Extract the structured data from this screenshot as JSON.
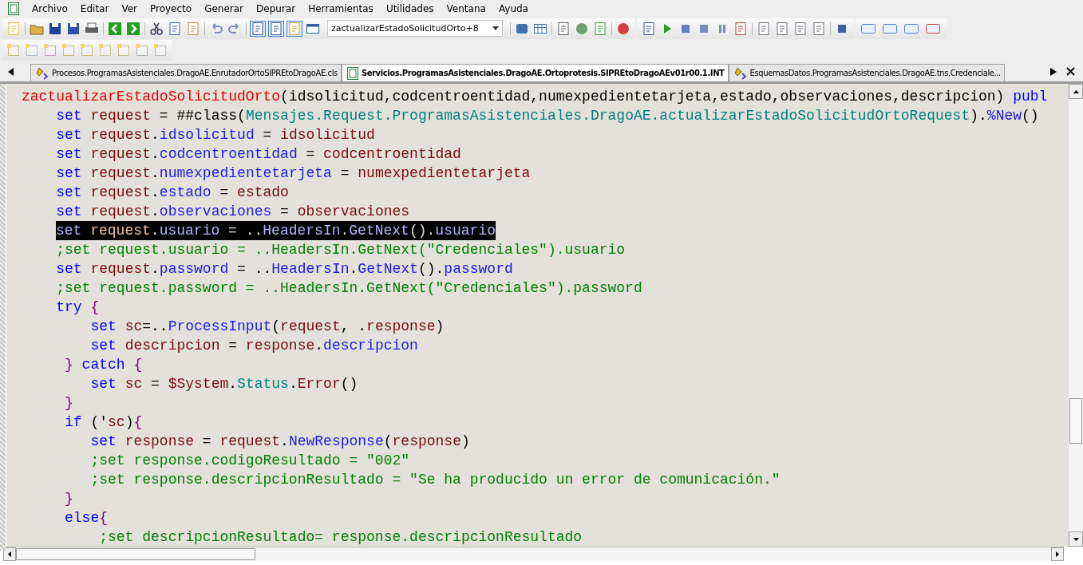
{
  "menu": [
    "Archivo",
    "Editar",
    "Ver",
    "Proyecto",
    "Generar",
    "Depurar",
    "Herramientas",
    "Utilidades",
    "Ventana",
    "Ayuda"
  ],
  "toolbar": {
    "dropdown": "zactualizarEstadoSolicitudOrto+8"
  },
  "tabs": [
    {
      "label": "Procesos.ProgramasAsistenciales.DragoAE.EnrutadorOrtoSIPREtoDragoAE.cls",
      "selected": false
    },
    {
      "label": "Servicios.ProgramasAsistenciales.DragoAE.Ortoprotesis.SIPREtoDragoAEv01r00.1.INT",
      "selected": true
    },
    {
      "label": "EsquemasDatos.ProgramasAsistenciales.DragoAE.tns.Credenciale...",
      "selected": false
    }
  ],
  "code": [
    {
      "highlighted": false,
      "tokens": [
        {
          "kind": "method",
          "text": "zactualizarEstadoSolicitudOrto"
        },
        {
          "kind": "plain",
          "text": "(idsolicitud,codcentroentidad,numexpedientetarjeta,estado,observaciones,descripcion) "
        },
        {
          "kind": "kw",
          "text": "publ"
        }
      ]
    },
    {
      "highlighted": false,
      "tokens": [
        {
          "kind": "kw",
          "text": "    set"
        },
        {
          "kind": "var",
          "text": " request"
        },
        {
          "kind": "plain",
          "text": " = ##class("
        },
        {
          "kind": "cls",
          "text": "Mensajes.Request.ProgramasAsistenciales.DragoAE.actualizarEstadoSolicitudOrtoRequest"
        },
        {
          "kind": "plain",
          "text": ")."
        },
        {
          "kind": "prop",
          "text": "%New"
        },
        {
          "kind": "plain",
          "text": "()"
        }
      ]
    },
    {
      "highlighted": false,
      "tokens": [
        {
          "kind": "kw",
          "text": "    set"
        },
        {
          "kind": "var",
          "text": " request"
        },
        {
          "kind": "plain",
          "text": "."
        },
        {
          "kind": "prop",
          "text": "idsolicitud"
        },
        {
          "kind": "plain",
          "text": " = "
        },
        {
          "kind": "var",
          "text": "idsolicitud"
        }
      ]
    },
    {
      "highlighted": false,
      "tokens": [
        {
          "kind": "kw",
          "text": "    set"
        },
        {
          "kind": "var",
          "text": " request"
        },
        {
          "kind": "plain",
          "text": "."
        },
        {
          "kind": "prop",
          "text": "codcentroentidad"
        },
        {
          "kind": "plain",
          "text": " = "
        },
        {
          "kind": "var",
          "text": "codcentroentidad"
        }
      ]
    },
    {
      "highlighted": false,
      "tokens": [
        {
          "kind": "kw",
          "text": "    set"
        },
        {
          "kind": "var",
          "text": " request"
        },
        {
          "kind": "plain",
          "text": "."
        },
        {
          "kind": "prop",
          "text": "numexpedientetarjeta"
        },
        {
          "kind": "plain",
          "text": " = "
        },
        {
          "kind": "var",
          "text": "numexpedientetarjeta"
        }
      ]
    },
    {
      "highlighted": false,
      "tokens": [
        {
          "kind": "kw",
          "text": "    set"
        },
        {
          "kind": "var",
          "text": " request"
        },
        {
          "kind": "plain",
          "text": "."
        },
        {
          "kind": "prop",
          "text": "estado"
        },
        {
          "kind": "plain",
          "text": " = "
        },
        {
          "kind": "var",
          "text": "estado"
        }
      ]
    },
    {
      "highlighted": false,
      "tokens": [
        {
          "kind": "kw",
          "text": "    set"
        },
        {
          "kind": "var",
          "text": " request"
        },
        {
          "kind": "plain",
          "text": "."
        },
        {
          "kind": "prop",
          "text": "observaciones"
        },
        {
          "kind": "plain",
          "text": " = "
        },
        {
          "kind": "var",
          "text": "observaciones"
        }
      ]
    },
    {
      "highlighted": true,
      "tokens": [
        {
          "kind": "kw",
          "text": "set"
        },
        {
          "kind": "var",
          "text": " request"
        },
        {
          "kind": "plain",
          "text": "."
        },
        {
          "kind": "prop",
          "text": "usuario"
        },
        {
          "kind": "plain",
          "text": " = .."
        },
        {
          "kind": "prop",
          "text": "HeadersIn"
        },
        {
          "kind": "plain",
          "text": "."
        },
        {
          "kind": "prop",
          "text": "GetNext"
        },
        {
          "kind": "plain",
          "text": "()."
        },
        {
          "kind": "prop",
          "text": "usuario"
        }
      ]
    },
    {
      "highlighted": false,
      "tokens": [
        {
          "kind": "comment",
          "text": "    ;set request.usuario = ..HeadersIn.GetNext(\"Credenciales\").usuario"
        }
      ]
    },
    {
      "highlighted": false,
      "tokens": [
        {
          "kind": "kw",
          "text": "    set"
        },
        {
          "kind": "var",
          "text": " request"
        },
        {
          "kind": "plain",
          "text": "."
        },
        {
          "kind": "prop",
          "text": "password"
        },
        {
          "kind": "plain",
          "text": " = .."
        },
        {
          "kind": "prop",
          "text": "HeadersIn"
        },
        {
          "kind": "plain",
          "text": "."
        },
        {
          "kind": "prop",
          "text": "GetNext"
        },
        {
          "kind": "plain",
          "text": "()."
        },
        {
          "kind": "prop",
          "text": "password"
        }
      ]
    },
    {
      "highlighted": false,
      "tokens": [
        {
          "kind": "comment",
          "text": "    ;set request.password = ..HeadersIn.GetNext(\"Credenciales\").password"
        }
      ]
    },
    {
      "highlighted": false,
      "tokens": [
        {
          "kind": "kw",
          "text": "    try"
        },
        {
          "kind": "brace",
          "text": " {"
        }
      ]
    },
    {
      "highlighted": false,
      "tokens": [
        {
          "kind": "kw",
          "text": "        set"
        },
        {
          "kind": "var",
          "text": " sc"
        },
        {
          "kind": "plain",
          "text": "=.."
        },
        {
          "kind": "prop",
          "text": "ProcessInput"
        },
        {
          "kind": "plain",
          "text": "("
        },
        {
          "kind": "var",
          "text": "request"
        },
        {
          "kind": "plain",
          "text": ", ."
        },
        {
          "kind": "var",
          "text": "response"
        },
        {
          "kind": "plain",
          "text": ")"
        }
      ]
    },
    {
      "highlighted": false,
      "tokens": [
        {
          "kind": "kw",
          "text": "        set"
        },
        {
          "kind": "var",
          "text": " descripcion"
        },
        {
          "kind": "plain",
          "text": " = "
        },
        {
          "kind": "var",
          "text": "response"
        },
        {
          "kind": "plain",
          "text": "."
        },
        {
          "kind": "prop",
          "text": "descripcion"
        }
      ]
    },
    {
      "highlighted": false,
      "tokens": [
        {
          "kind": "brace",
          "text": "     }"
        },
        {
          "kind": "kw",
          "text": " catch"
        },
        {
          "kind": "brace",
          "text": " {"
        }
      ]
    },
    {
      "highlighted": false,
      "tokens": [
        {
          "kind": "kw",
          "text": "        set"
        },
        {
          "kind": "var",
          "text": " sc"
        },
        {
          "kind": "plain",
          "text": " = "
        },
        {
          "kind": "var",
          "text": "$System"
        },
        {
          "kind": "plain",
          "text": "."
        },
        {
          "kind": "cls",
          "text": "Status"
        },
        {
          "kind": "plain",
          "text": "."
        },
        {
          "kind": "var",
          "text": "Error"
        },
        {
          "kind": "plain",
          "text": "()"
        }
      ]
    },
    {
      "highlighted": false,
      "tokens": [
        {
          "kind": "brace",
          "text": "     }"
        }
      ]
    },
    {
      "highlighted": false,
      "tokens": [
        {
          "kind": "kw",
          "text": "     if"
        },
        {
          "kind": "plain",
          "text": " ('"
        },
        {
          "kind": "var",
          "text": "sc"
        },
        {
          "kind": "plain",
          "text": ")"
        },
        {
          "kind": "brace",
          "text": "{"
        }
      ]
    },
    {
      "highlighted": false,
      "tokens": [
        {
          "kind": "kw",
          "text": "        set"
        },
        {
          "kind": "var",
          "text": " response"
        },
        {
          "kind": "plain",
          "text": " = "
        },
        {
          "kind": "var",
          "text": "request"
        },
        {
          "kind": "plain",
          "text": "."
        },
        {
          "kind": "prop",
          "text": "NewResponse"
        },
        {
          "kind": "plain",
          "text": "("
        },
        {
          "kind": "var",
          "text": "response"
        },
        {
          "kind": "plain",
          "text": ")"
        }
      ]
    },
    {
      "highlighted": false,
      "tokens": [
        {
          "kind": "comment",
          "text": "        ;set response.codigoResultado = \"002\""
        }
      ]
    },
    {
      "highlighted": false,
      "tokens": [
        {
          "kind": "comment",
          "text": "        ;set response.descripcionResultado = \"Se ha producido un error de comunicación.\""
        }
      ]
    },
    {
      "highlighted": false,
      "tokens": [
        {
          "kind": "brace",
          "text": "     }"
        }
      ]
    },
    {
      "highlighted": false,
      "tokens": [
        {
          "kind": "kw",
          "text": "     else"
        },
        {
          "kind": "brace",
          "text": "{"
        }
      ]
    },
    {
      "highlighted": false,
      "tokens": [
        {
          "kind": "comment",
          "text": "         ;set descripcionResultado= response.descripcionResultado"
        }
      ]
    }
  ]
}
